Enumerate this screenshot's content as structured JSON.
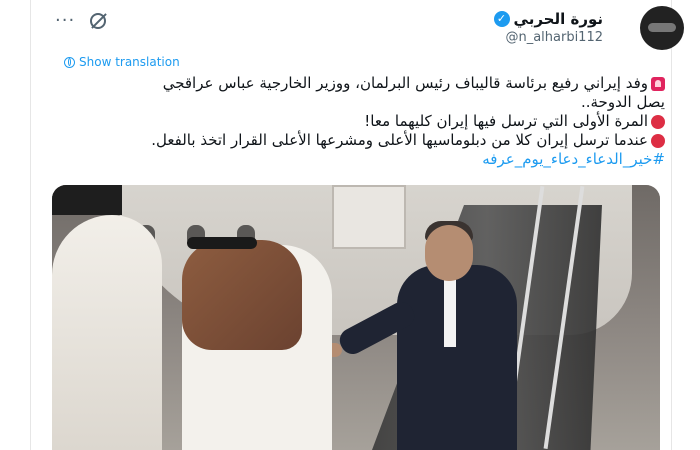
{
  "post": {
    "author": {
      "display_name": "نورة الحربي",
      "handle": "@n_alharbi112",
      "verified": true
    },
    "show_translation_label": "Show translation",
    "text_lines": [
      "وفد إيراني رفيع برئاسة قاليباف رئيس البرلمان، ووزير الخارجية عباس عراقجي",
      "يصل الدوحة..",
      "المرة الأولى التي ترسل فيها إيران كليهما معا!",
      "عندما ترسل إيران كلا من دبلوماسيها الأعلى ومشرعها الأعلى القرار اتخذ بالفعل.",
      "#خير_الدعاء_دعاء_يوم_عرفه"
    ],
    "accent_color": "#1d9bf0"
  },
  "icons": {
    "verified": "verified-badge-icon",
    "grok": "grok-icon",
    "more": "more-options-icon",
    "translate": "globe-icon",
    "siren": "siren-emoji-icon",
    "bullet": "red-circle-emoji-icon"
  }
}
